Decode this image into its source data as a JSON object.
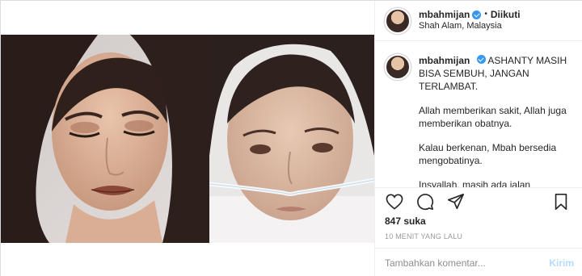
{
  "header": {
    "username": "mbahmijan",
    "separator": "•",
    "follow_status": "Diikuti",
    "location": "Shah Alam, Malaysia"
  },
  "caption": {
    "username": "mbahmijan",
    "paragraphs": [
      "ASHANTY MASIH BISA SEMBUH, JANGAN TERLAMBAT.",
      "Allah memberikan sakit, Allah juga memberikan obatnya.",
      "Kalau berkenan, Mbah bersedia mengobatinya.",
      "Insyallah, masih ada jalan kesembuhan, tetap semangat Bu Ashanty Bismillah"
    ]
  },
  "actions": {
    "like_icon": "heart-icon",
    "comment_icon": "comment-icon",
    "share_icon": "share-icon",
    "save_icon": "bookmark-icon"
  },
  "likes": "847 suka",
  "timestamp": "10 MENIT YANG LALU",
  "comment": {
    "placeholder": "Tambahkan komentar...",
    "post_label": "Kirim"
  },
  "colors": {
    "verified": "#3897f0",
    "post_disabled": "#b3dbff",
    "border": "#dbdbdb"
  }
}
